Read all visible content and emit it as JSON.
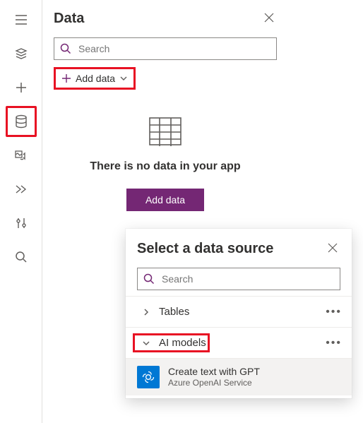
{
  "panel": {
    "title": "Data",
    "search_placeholder": "Search",
    "add_data_label": "Add data",
    "empty_message": "There is no data in your app",
    "empty_button": "Add data"
  },
  "nav": {
    "hamburger": "menu",
    "items": [
      "layers",
      "insert",
      "data",
      "media",
      "advanced",
      "settings",
      "search"
    ]
  },
  "popup": {
    "title": "Select a data source",
    "search_placeholder": "Search",
    "categories": [
      {
        "label": "Tables",
        "expanded": false
      },
      {
        "label": "AI models",
        "expanded": true
      }
    ],
    "ai_sources": [
      {
        "name": "Create text with GPT",
        "subtitle": "Azure OpenAI Service"
      }
    ]
  },
  "highlights": [
    "nav-data",
    "add-data-dropdown",
    "category-ai-models"
  ]
}
